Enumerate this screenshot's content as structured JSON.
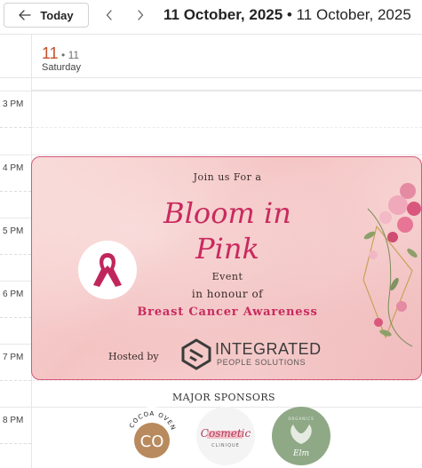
{
  "toolbar": {
    "today_label": "Today",
    "range_title_bold": "11 October, 2025",
    "range_separator": " • ",
    "range_title_rest": "11 October, 2025",
    "prev_icon": "chevron-left-icon",
    "next_icon": "chevron-right-icon"
  },
  "day": {
    "number": "11",
    "separator": " • ",
    "sub_number": "11",
    "weekday": "Saturday",
    "accent_color": "#c4512a"
  },
  "hours": [
    "3 PM",
    "4 PM",
    "5 PM",
    "6 PM",
    "7 PM",
    "8 PM"
  ],
  "event": {
    "join": "Join us For a",
    "title_line1": "Bloom in",
    "title_line2": "Pink",
    "event_word": "Event",
    "honour": "in honour of",
    "cause": "Breast Cancer Awareness",
    "hosted_by": "Hosted by",
    "host_name": "INTEGRATED",
    "host_sub": "PEOPLE SOLUTIONS",
    "border_color": "#d4587a",
    "title_color": "#c82a5e",
    "sponsors_title": "MAJOR SPONSORS",
    "sponsor1_name": "COCOA OVEN",
    "sponsor1_mono": "CO",
    "sponsor2_name": "Cosmetic",
    "sponsor2_sub": "CLINIQUE",
    "sponsor3_top": "ORGANICS",
    "sponsor3_name": "Elm"
  }
}
